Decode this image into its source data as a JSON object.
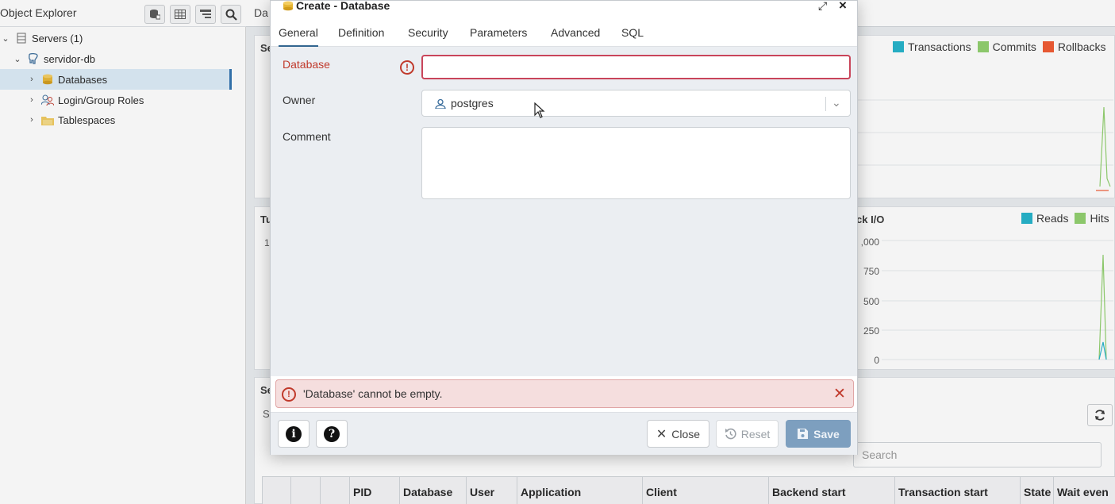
{
  "explorer": {
    "title": "Object Explorer",
    "tree": [
      {
        "label": "Servers (1)"
      },
      {
        "label": "servidor-db"
      },
      {
        "label": "Databases"
      },
      {
        "label": "Login/Group Roles"
      },
      {
        "label": "Tablespaces"
      }
    ]
  },
  "dashboard": {
    "tab_label": "Da",
    "panel1_title": "Se",
    "panel2_title": "Tu",
    "panel2_value": "1",
    "panel3_title": "ck I/O",
    "activity_title": "Se",
    "activity_subtab": "S",
    "legend1": [
      {
        "label": "Transactions",
        "color": "#1fb1c9"
      },
      {
        "label": "Commits",
        "color": "#8fcf6b"
      },
      {
        "label": "Rollbacks",
        "color": "#f0562d"
      }
    ],
    "legend2": [
      {
        "label": "Reads",
        "color": "#1fb1c9"
      },
      {
        "label": "Hits",
        "color": "#8fcf6b"
      }
    ],
    "io_ticks": [
      ",000",
      "750",
      "500",
      "250",
      "0"
    ],
    "search_placeholder": "Search",
    "table_columns": [
      "",
      "",
      "",
      "PID",
      "Database",
      "User",
      "Application",
      "Client",
      "Backend start",
      "Transaction start",
      "State",
      "Wait even"
    ]
  },
  "dialog": {
    "title": "Create - Database",
    "tabs": [
      "General",
      "Definition",
      "Security",
      "Parameters",
      "Advanced",
      "SQL"
    ],
    "active_tab": "General",
    "fields": {
      "database_label": "Database",
      "database_value": "",
      "owner_label": "Owner",
      "owner_value": "postgres",
      "comment_label": "Comment",
      "comment_value": ""
    },
    "error_message": "'Database' cannot be empty.",
    "buttons": {
      "close": "Close",
      "reset": "Reset",
      "save": "Save"
    }
  }
}
